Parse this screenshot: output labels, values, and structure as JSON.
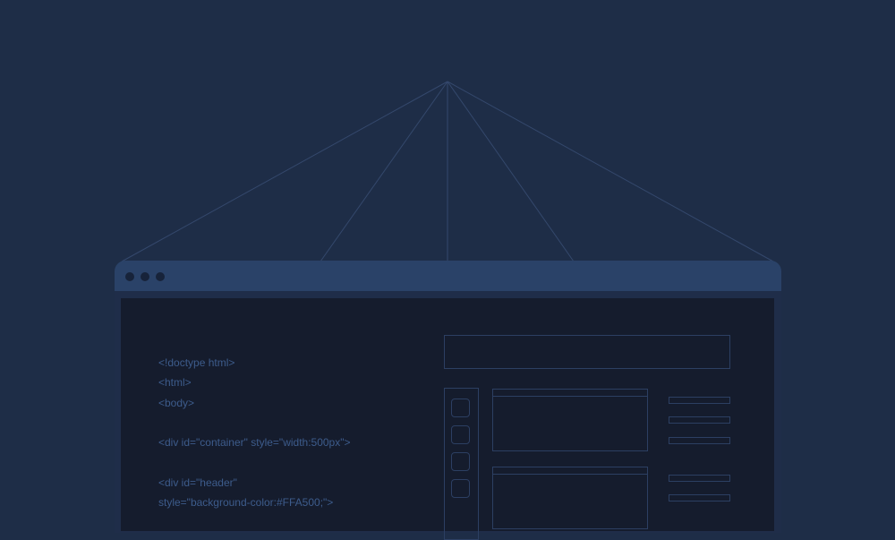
{
  "window": {
    "title_dots": [
      "close-dot",
      "minimize-dot",
      "maximize-dot"
    ]
  },
  "editor": {
    "code_lines": [
      "<!doctype html>",
      "<html>",
      "<body>",
      "",
      "<div id=\"container\" style=\"width:500px\">",
      "",
      "<div id=\"header\"",
      "style=\"background-color:#FFA500;\">"
    ]
  },
  "colors": {
    "background": "#1e2d47",
    "window_chrome": "#2a4268",
    "screen": "#151c2d",
    "code_text": "#3d5c8c",
    "wireframe": "#2c3f62"
  }
}
